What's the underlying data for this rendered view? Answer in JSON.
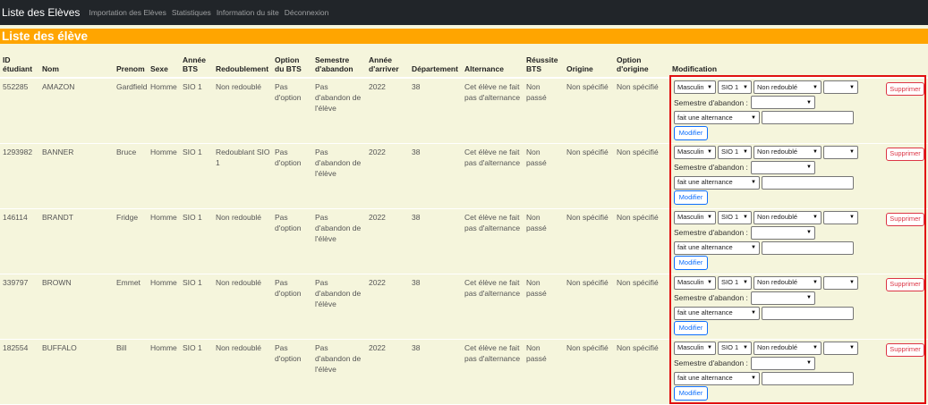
{
  "navbar": {
    "brand": "Liste des Elèves",
    "links": [
      "Importation des Elèves",
      "Statistiques",
      "Information du site",
      "Déconnexion"
    ]
  },
  "section_title": "Liste des élève",
  "columns": [
    "ID étudiant",
    "Nom",
    "Prenom",
    "Sexe",
    "Année BTS",
    "Redoublement",
    "Option du BTS",
    "Semestre d'abandon",
    "Année d'arriver",
    "Département",
    "Alternance",
    "Réussite BTS",
    "Origine",
    "Option d'origine",
    "Modification"
  ],
  "rows": [
    {
      "id": "552285",
      "nom": "AMAZON",
      "prenom": "Gardfield",
      "sexe": "Homme",
      "annee": "SIO 1",
      "redoublement": "Non redoublé",
      "option": "Pas d'option",
      "semestre": "Pas d'abandon de l'élève",
      "arrivee": "2022",
      "departement": "38",
      "alternance": "Cet élève ne fait pas d'alternance",
      "reussite": "Non passé",
      "origine": "Non spécifié",
      "option_origine": "Non spécifié",
      "sel_sexe": "Masculin",
      "sel_annee": "SIO 1",
      "sel_redoublement": "Non redoublé",
      "sel_alternance": "fait une alternance"
    },
    {
      "id": "1293982",
      "nom": "BANNER",
      "prenom": "Bruce",
      "sexe": "Homme",
      "annee": "SIO 1",
      "redoublement": "Redoublant SIO 1",
      "option": "Pas d'option",
      "semestre": "Pas d'abandon de l'élève",
      "arrivee": "2022",
      "departement": "38",
      "alternance": "Cet élève ne fait pas d'alternance",
      "reussite": "Non passé",
      "origine": "Non spécifié",
      "option_origine": "Non spécifié",
      "sel_sexe": "Masculin",
      "sel_annee": "SIO 1",
      "sel_redoublement": "Non redoublé",
      "sel_alternance": "fait une alternance"
    },
    {
      "id": "146114",
      "nom": "BRANDT",
      "prenom": "Fridge",
      "sexe": "Homme",
      "annee": "SIO 1",
      "redoublement": "Non redoublé",
      "option": "Pas d'option",
      "semestre": "Pas d'abandon de l'élève",
      "arrivee": "2022",
      "departement": "38",
      "alternance": "Cet élève ne fait pas d'alternance",
      "reussite": "Non passé",
      "origine": "Non spécifié",
      "option_origine": "Non spécifié",
      "sel_sexe": "Masculin",
      "sel_annee": "SIO 1",
      "sel_redoublement": "Non redoublé",
      "sel_alternance": "fait une alternance"
    },
    {
      "id": "339797",
      "nom": "BROWN",
      "prenom": "Emmet",
      "sexe": "Homme",
      "annee": "SIO 1",
      "redoublement": "Non redoublé",
      "option": "Pas d'option",
      "semestre": "Pas d'abandon de l'élève",
      "arrivee": "2022",
      "departement": "38",
      "alternance": "Cet élève ne fait pas d'alternance",
      "reussite": "Non passé",
      "origine": "Non spécifié",
      "option_origine": "Non spécifié",
      "sel_sexe": "Masculin",
      "sel_annee": "SIO 1",
      "sel_redoublement": "Non redoublé",
      "sel_alternance": "fait une alternance"
    },
    {
      "id": "182554",
      "nom": "BUFFALO",
      "prenom": "Bill",
      "sexe": "Homme",
      "annee": "SIO 1",
      "redoublement": "Non redoublé",
      "option": "Pas d'option",
      "semestre": "Pas d'abandon de l'élève",
      "arrivee": "2022",
      "departement": "38",
      "alternance": "Cet élève ne fait pas d'alternance",
      "reussite": "Non passé",
      "origine": "Non spécifié",
      "option_origine": "Non spécifié",
      "sel_sexe": "Masculin",
      "sel_annee": "SIO 1",
      "sel_redoublement": "Non redoublé",
      "sel_alternance": "fait une alternance"
    }
  ],
  "form": {
    "semestre_label": "Semestre d'abandon :",
    "modifier_label": "Modifier",
    "supprimer_label": "Supprimer"
  },
  "icons": {
    "select_arrow": "chevron-down-icon"
  },
  "colors": {
    "navbar_bg": "#212529",
    "section_title_bg": "#ffa500",
    "table_bg": "#f5f5dc",
    "modifier_button": "#0d6efd",
    "supprimer_button": "#dc3545",
    "highlight_box": "#e01010"
  }
}
